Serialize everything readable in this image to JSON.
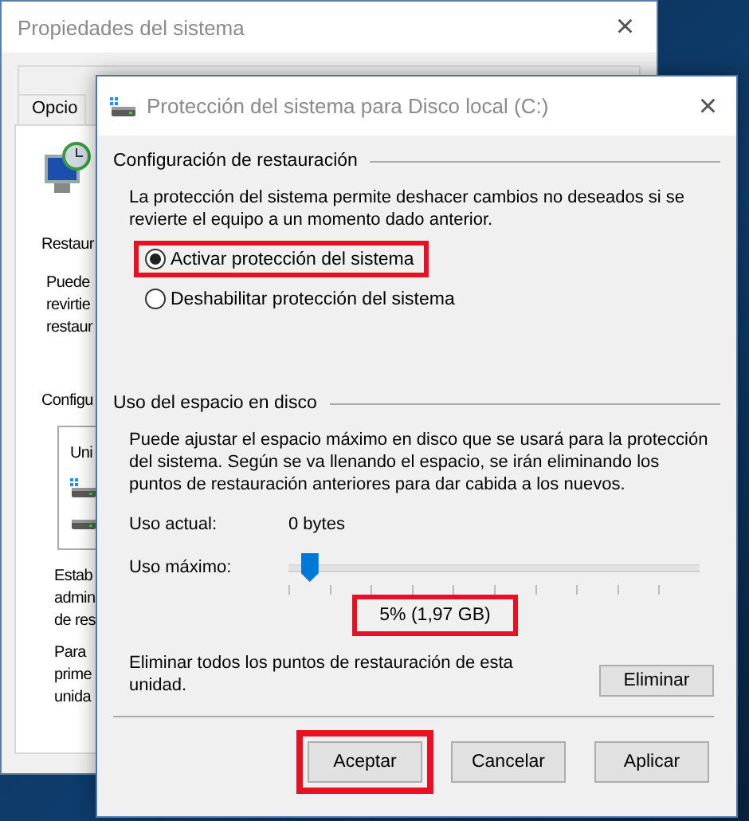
{
  "back_window": {
    "title": "Propiedades del sistema",
    "close": "×",
    "tab": "Opcio",
    "section_label": "Restaur",
    "section_text": [
      "Puede",
      "revirtie",
      "restaur"
    ],
    "config_label": "Configu",
    "list_header": "Uni",
    "notes": [
      [
        "Estab",
        "admin",
        "de res"
      ],
      [
        "Para",
        "prime",
        "unida"
      ]
    ]
  },
  "dialog": {
    "title": "Protección del sistema para Disco local (C:)",
    "close": "×",
    "restore_group": {
      "heading": "Configuración de restauración",
      "description": "La protección del sistema permite deshacer cambios no deseados si se revierte el equipo a un momento dado anterior.",
      "options": [
        {
          "label": "Activar protección del sistema",
          "selected": true,
          "highlighted": true
        },
        {
          "label": "Deshabilitar protección del sistema",
          "selected": false,
          "highlighted": false
        }
      ]
    },
    "disk_group": {
      "heading": "Uso del espacio en disco",
      "description": "Puede ajustar el espacio máximo en disco que se usará para la protección del sistema. Según se va llenando el espacio, se irán eliminando los puntos de restauración anteriores para dar cabida a los nuevos.",
      "current_label": "Uso actual:",
      "current_value": "0 bytes",
      "max_label": "Uso máximo:",
      "max_slider": {
        "level": 0.05
      },
      "max_value": {
        "text": "5% (1,97 GB)",
        "highlighted": true
      },
      "delete_text": "Eliminar todos los puntos de restauración de esta unidad.",
      "delete_button": "Eliminar"
    },
    "buttons": [
      {
        "label": "Aceptar",
        "highlighted": true
      },
      {
        "label": "Cancelar",
        "highlighted": false
      },
      {
        "label": "Aplicar",
        "highlighted": false
      }
    ]
  }
}
